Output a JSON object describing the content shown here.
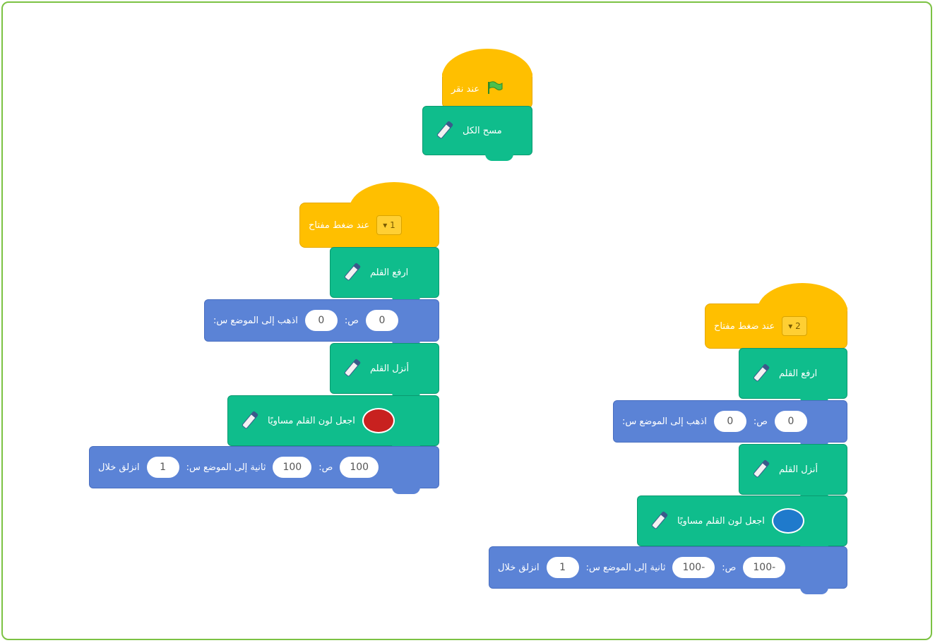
{
  "script1": {
    "hat_label": "عند نقر",
    "clear_label": "مسح الكل"
  },
  "script2": {
    "hat_label": "عند ضغط مفتاح",
    "key": "1",
    "pen_up": "ارفع القلم",
    "goto_label": "اذهب إلى الموضع س:",
    "goto_x": "0",
    "goto_y_label": "ص:",
    "goto_y": "0",
    "pen_down": "أنزل القلم",
    "set_color": "اجعل لون القلم مساويًا",
    "color": "#c8211f",
    "glide_label": "انزلق خلال",
    "glide_secs": "1",
    "glide_mid": "ثانية إلى الموضع س:",
    "glide_x": "100",
    "glide_y_label": "ص:",
    "glide_y": "100"
  },
  "script3": {
    "hat_label": "عند ضغط مفتاح",
    "key": "2",
    "pen_up": "ارفع القلم",
    "goto_label": "اذهب إلى الموضع س:",
    "goto_x": "0",
    "goto_y_label": "ص:",
    "goto_y": "0",
    "pen_down": "أنزل القلم",
    "set_color": "اجعل لون القلم مساويًا",
    "color": "#1f7acc",
    "glide_label": "انزلق خلال",
    "glide_secs": "1",
    "glide_mid": "ثانية إلى الموضع س:",
    "glide_x": "-100",
    "glide_y_label": "ص:",
    "glide_y": "-100"
  }
}
